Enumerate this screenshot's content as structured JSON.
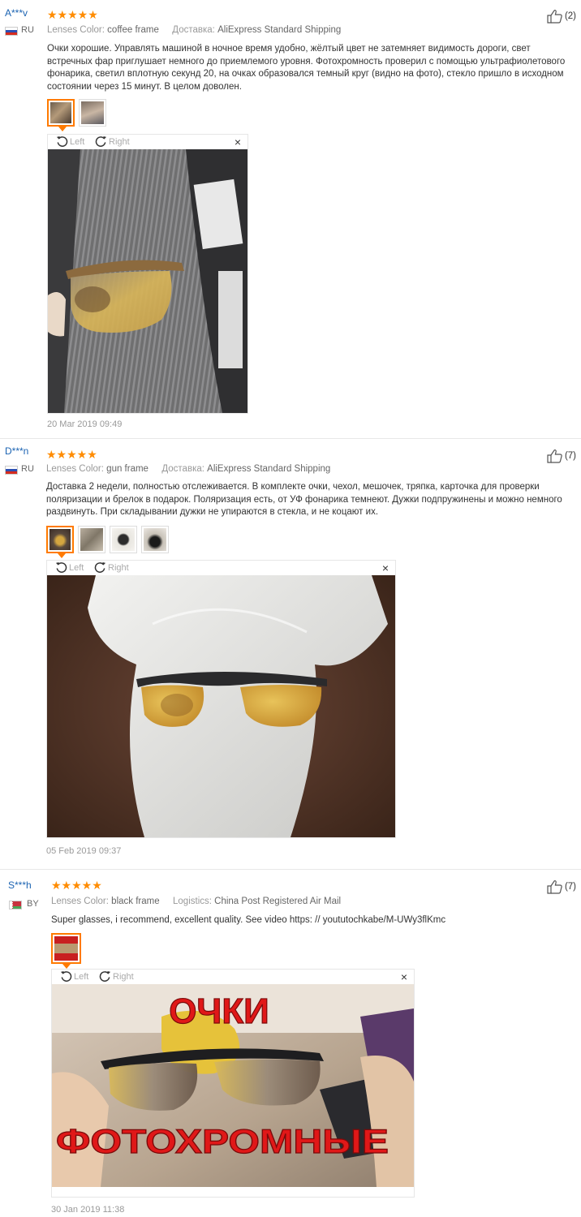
{
  "reviews": [
    {
      "user": "A***v",
      "country": "RU",
      "stars": "★★★★★",
      "meta1_label": "Lenses Color:",
      "meta1_value": "coffee frame",
      "meta2_label": "Доставка:",
      "meta2_value": "AliExpress Standard Shipping",
      "helpful": "(2)",
      "text": "Очки хорошие. Управлять машиной в ночное время удобно, жёлтый цвет не затемняет видимость дороги, свет встречных фар приглушает немного до приемлемого уровня. Фотохромность проверил с помощью ультрафиолетового фонарика, светил вплотную секунд 20, на очках образовался темный круг (видно на фото), стекло пришло в исходном состоянии через 15 минут. В целом доволен.",
      "rotate_left": "Left",
      "rotate_right": "Right",
      "close": "×",
      "date": "20 Mar 2019 09:49"
    },
    {
      "user": "D***n",
      "country": "RU",
      "stars": "★★★★★",
      "meta1_label": "Lenses Color:",
      "meta1_value": "gun frame",
      "meta2_label": "Доставка:",
      "meta2_value": "AliExpress Standard Shipping",
      "helpful": "(7)",
      "text": "Доставка 2 недели, полностью отслеживается. В комплекте очки, чехол, мешочек, тряпка, карточка для проверки поляризации и брелок в подарок. Поляризация есть, от УФ фонарика темнеют. Дужки подпружинены и можно немного раздвинуть. При складывании дужки не упираются в стекла, и не коцают их.",
      "rotate_left": "Left",
      "rotate_right": "Right",
      "close": "×",
      "date": "05 Feb 2019 09:37"
    },
    {
      "user": "S***h",
      "country": "BY",
      "stars": "★★★★★",
      "meta1_label": "Lenses Color:",
      "meta1_value": "black frame",
      "meta2_label": "Logistics:",
      "meta2_value": "China Post Registered Air Mail",
      "helpful": "(7)",
      "text": "Super glasses, i recommend, excellent quality. See video https: // yoututochkabe/M-UWy3flKmc",
      "rotate_left": "Left",
      "rotate_right": "Right",
      "close": "×",
      "photo_caption_top": "ОЧКИ",
      "photo_caption_bottom": "ФОТОХРОМНЫЕ",
      "date": "30 Jan 2019 11:38"
    }
  ],
  "colors": {
    "username": "#1b63b2",
    "stars": "#ff8c00",
    "active_thumb": "#ff7a00",
    "caption_red": "#e01818"
  }
}
